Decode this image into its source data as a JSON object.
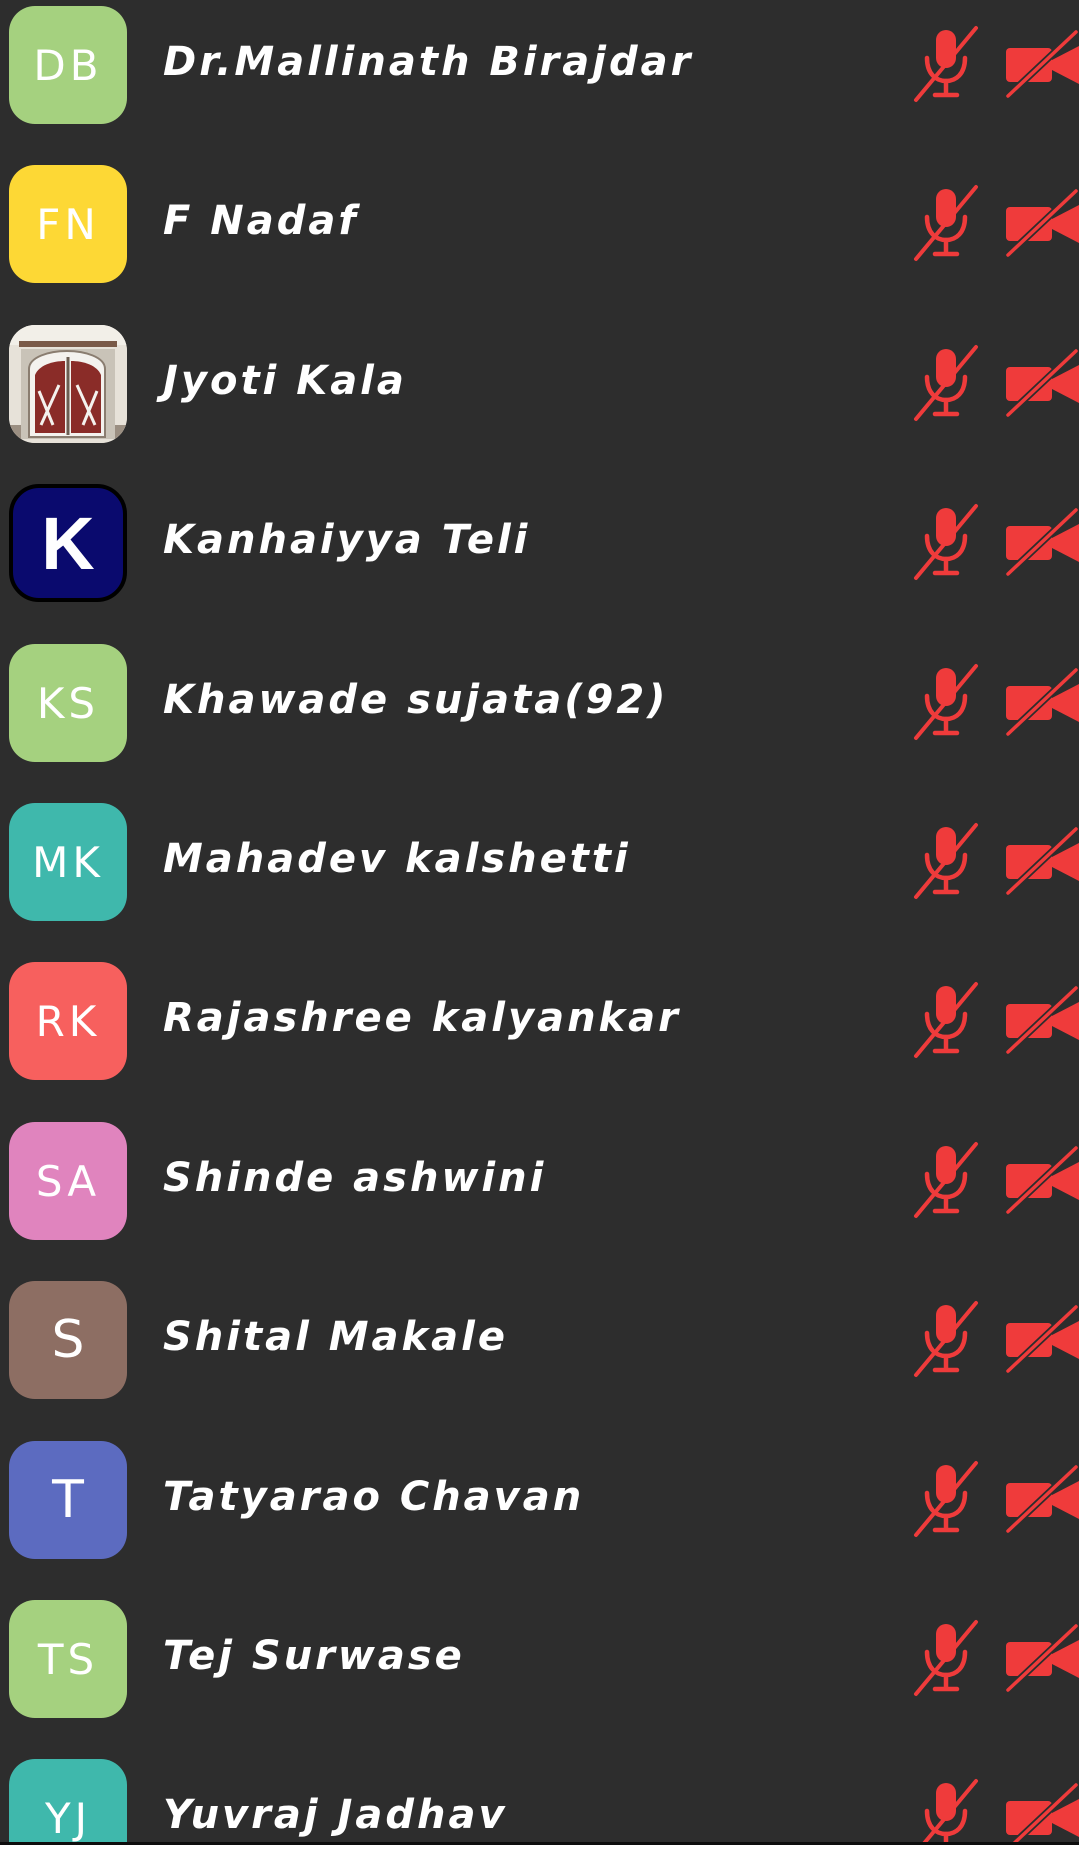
{
  "participants": [
    {
      "initials": "DB",
      "name": "Dr.Mallinath Birajdar",
      "avatar_color": "#a5d17f",
      "avatar_type": "initials"
    },
    {
      "initials": "FN",
      "name": "F Nadaf",
      "avatar_color": "#fdd835",
      "avatar_type": "initials"
    },
    {
      "initials": "",
      "name": "Jyoti Kala",
      "avatar_color": "#d8d2c8",
      "avatar_type": "photo"
    },
    {
      "initials": "K",
      "name": "Kanhaiyya Teli",
      "avatar_color": "#0a0a6e",
      "avatar_type": "bold-letter"
    },
    {
      "initials": "KS",
      "name": "Khawade sujata(92)",
      "avatar_color": "#a5d17f",
      "avatar_type": "initials"
    },
    {
      "initials": "MK",
      "name": "Mahadev kalshetti",
      "avatar_color": "#3fb8ac",
      "avatar_type": "initials"
    },
    {
      "initials": "RK",
      "name": "Rajashree kalyankar",
      "avatar_color": "#f7605e",
      "avatar_type": "initials"
    },
    {
      "initials": "SA",
      "name": "Shinde ashwini",
      "avatar_color": "#e084be",
      "avatar_type": "initials"
    },
    {
      "initials": "S",
      "name": "Shital Makale",
      "avatar_color": "#8d6e63",
      "avatar_type": "single"
    },
    {
      "initials": "T",
      "name": "Tatyarao Chavan",
      "avatar_color": "#5c6bc0",
      "avatar_type": "single"
    },
    {
      "initials": "TS",
      "name": "Tej Surwase",
      "avatar_color": "#a5d17f",
      "avatar_type": "initials"
    },
    {
      "initials": "YJ",
      "name": "Yuvraj Jadhav",
      "avatar_color": "#3fb8ac",
      "avatar_type": "initials"
    }
  ],
  "icons": {
    "mic": "mic-muted-icon",
    "camera": "camera-off-icon"
  },
  "colors": {
    "background": "#2d2d2d",
    "muted_red": "#ef3b3b",
    "text": "#ffffff"
  }
}
